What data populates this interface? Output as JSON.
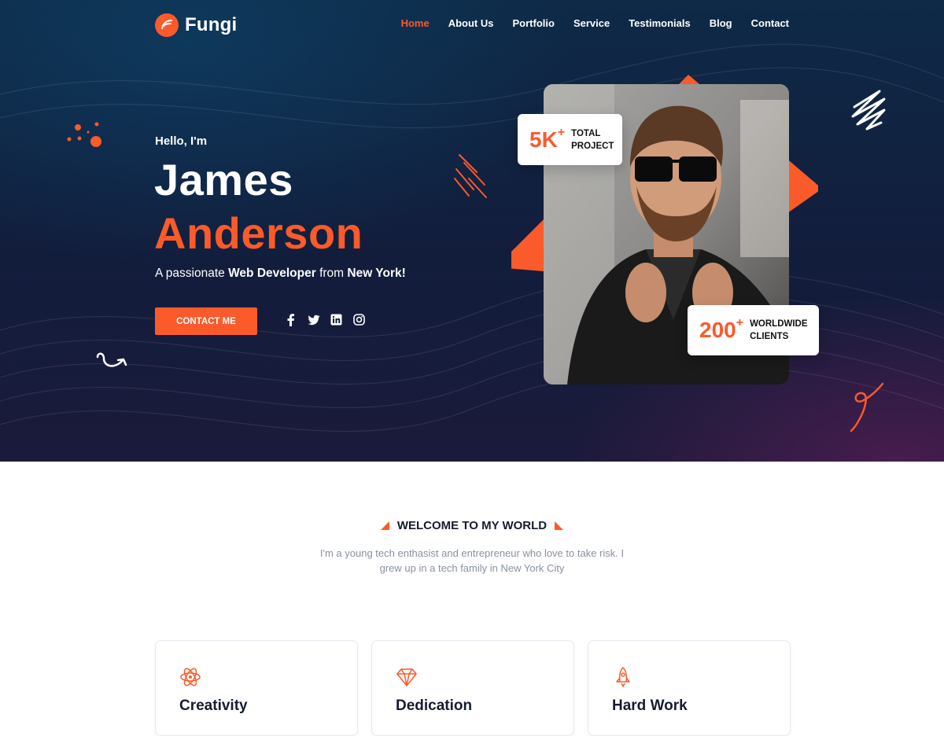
{
  "brand": {
    "name": "Fungi"
  },
  "nav": {
    "items": [
      {
        "label": "Home",
        "active": true
      },
      {
        "label": "About Us",
        "active": false
      },
      {
        "label": "Portfolio",
        "active": false
      },
      {
        "label": "Service",
        "active": false
      },
      {
        "label": "Testimonials",
        "active": false
      },
      {
        "label": "Blog",
        "active": false
      },
      {
        "label": "Contact",
        "active": false
      }
    ]
  },
  "hero": {
    "greeting": "Hello, I'm",
    "first_name": "James",
    "last_name": "Anderson",
    "tagline": {
      "prefix": "A passionate ",
      "role": "Web Developer",
      "middle": " from ",
      "city": "New York!"
    },
    "cta_label": "CONTACT ME",
    "socials": [
      "facebook-icon",
      "twitter-icon",
      "linkedin-icon",
      "instagram-icon"
    ]
  },
  "stats": [
    {
      "value": "5K",
      "suffix": "+",
      "label_line1": "TOTAL",
      "label_line2": "PROJECT"
    },
    {
      "value": "200",
      "suffix": "+",
      "label_line1": "WORLDWIDE",
      "label_line2": "CLIENTS"
    }
  ],
  "welcome": {
    "title": "WELCOME TO MY WORLD",
    "description": "I'm a young tech enthasist and entrepreneur who love to take risk. I grew up in a tech family in New York City"
  },
  "features": [
    {
      "title": "Creativity",
      "icon": "atom-icon"
    },
    {
      "title": "Dedication",
      "icon": "diamond-icon"
    },
    {
      "title": "Hard Work",
      "icon": "rocket-icon"
    }
  ],
  "colors": {
    "accent": "#fb5a2a",
    "hero_dark": "#121d3c",
    "heading": "#141c2f",
    "muted_text": "#8a90a2"
  }
}
